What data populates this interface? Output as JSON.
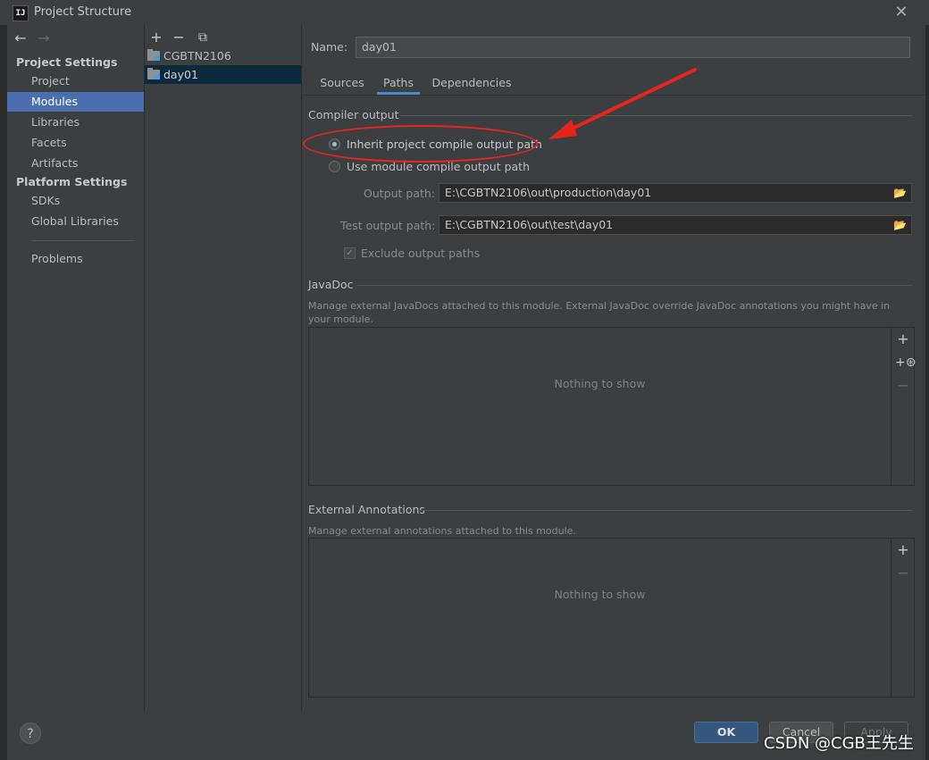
{
  "window": {
    "title": "Project Structure",
    "close_icon": "close-icon",
    "app_icon_text": "IJ"
  },
  "nav": {
    "back_icon": "←",
    "forward_icon": "→",
    "project_settings_header": "Project Settings",
    "project_items": [
      {
        "label": "Project",
        "selected": false
      },
      {
        "label": "Modules",
        "selected": true
      },
      {
        "label": "Libraries",
        "selected": false
      },
      {
        "label": "Facets",
        "selected": false
      },
      {
        "label": "Artifacts",
        "selected": false
      }
    ],
    "platform_settings_header": "Platform Settings",
    "platform_items": [
      {
        "label": "SDKs"
      },
      {
        "label": "Global Libraries"
      }
    ],
    "problems_label": "Problems"
  },
  "modules": {
    "toolbar": {
      "add": "+",
      "remove": "−",
      "copy": "⧉"
    },
    "items": [
      {
        "label": "CGBTN2106",
        "selected": false
      },
      {
        "label": "day01",
        "selected": true
      }
    ]
  },
  "main": {
    "name_label": "Name:",
    "name_value": "day01",
    "tabs": [
      {
        "label": "Sources",
        "active": false
      },
      {
        "label": "Paths",
        "active": true
      },
      {
        "label": "Dependencies",
        "active": false
      }
    ],
    "compiler_output": {
      "title": "Compiler output",
      "inherit_label": "Inherit project compile output path",
      "inherit_selected": true,
      "module_label": "Use module compile output path",
      "module_selected": false,
      "output_path_label": "Output path:",
      "output_path_value": "E:\\CGBTN2106\\out\\production\\day01",
      "test_output_path_label": "Test output path:",
      "test_output_path_value": "E:\\CGBTN2106\\out\\test\\day01",
      "exclude_label": "Exclude output paths",
      "exclude_checked": true
    },
    "javadoc": {
      "title": "JavaDoc",
      "description": "Manage external JavaDocs attached to this module. External JavaDoc override JavaDoc annotations you might have in your module.",
      "empty_text": "Nothing to show"
    },
    "external_annotations": {
      "title": "External Annotations",
      "description": "Manage external annotations attached to this module.",
      "empty_text": "Nothing to show"
    }
  },
  "footer": {
    "help": "?",
    "ok": "OK",
    "cancel": "Cancel",
    "apply": "Apply"
  },
  "watermark": "CSDN @CGB王先生",
  "colors": {
    "accent": "#4b6eaf",
    "ok_button": "#365880",
    "annotation": "#e8241a"
  }
}
